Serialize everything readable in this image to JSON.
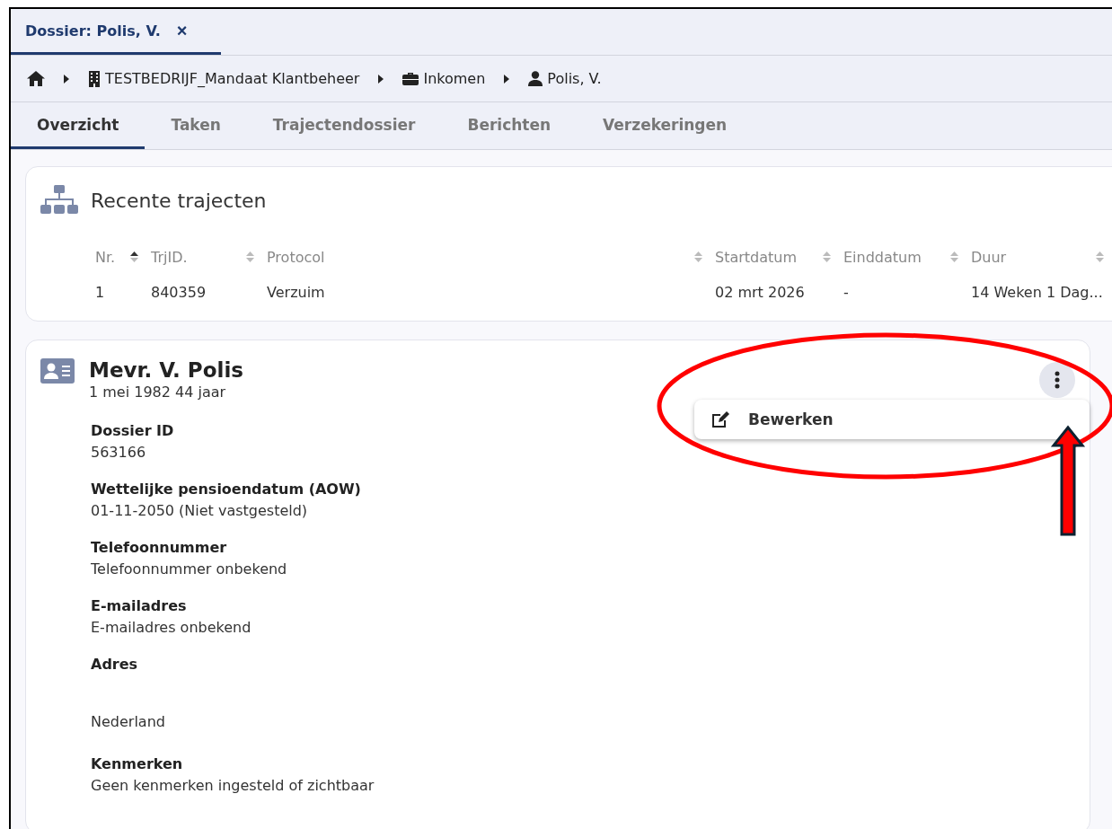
{
  "document_tab": {
    "title": "Dossier: Polis, V.",
    "close": "×"
  },
  "breadcrumb": [
    {
      "kind": "building",
      "label": "TESTBEDRIJF_Mandaat Klantbeheer"
    },
    {
      "kind": "briefcase",
      "label": "Inkomen"
    },
    {
      "kind": "user",
      "label": "Polis, V."
    }
  ],
  "tabs": [
    {
      "label": "Overzicht",
      "selected": true
    },
    {
      "label": "Taken",
      "selected": false
    },
    {
      "label": "Trajectendossier",
      "selected": false
    },
    {
      "label": "Berichten",
      "selected": false
    },
    {
      "label": "Verzekeringen",
      "selected": false
    }
  ],
  "recent": {
    "title": "Recente trajecten",
    "columns": [
      {
        "label": "Nr.",
        "sorted_ascending": true
      },
      {
        "label": "TrjID.",
        "sorted_ascending": false
      },
      {
        "label": "Protocol",
        "sorted_ascending": false
      },
      {
        "label": "Startdatum",
        "sorted_ascending": false
      },
      {
        "label": "Einddatum",
        "sorted_ascending": false
      },
      {
        "label": "Duur",
        "sorted_ascending": false
      }
    ],
    "rows": [
      [
        "1",
        "840359",
        "Verzuim",
        "02 mrt 2026",
        "-",
        "14 Weken 1 Dag..."
      ]
    ]
  },
  "person": {
    "name": "Mevr. V. Polis",
    "subtitle": "1 mei 1982 44 jaar",
    "menu": {
      "open": true,
      "items": [
        {
          "label": "Bewerken"
        }
      ]
    },
    "fields": [
      {
        "label": "Dossier ID",
        "value": "563166",
        "kind": "plain"
      },
      {
        "label": "Wettelijke pensioendatum (AOW)",
        "value": "01-11-2050 (Niet vastgesteld)",
        "kind": "plain"
      },
      {
        "label": "Telefoonnummer",
        "value": "Telefoonnummer onbekend",
        "kind": "plain"
      },
      {
        "label": "E-mailadres",
        "value": "E-mailadres onbekend",
        "kind": "plain"
      },
      {
        "label": "Adres",
        "value": "Nederland",
        "kind": "address"
      },
      {
        "label": "Kenmerken",
        "value": "Geen kenmerken ingesteld of zichtbaar",
        "kind": "plain"
      }
    ]
  },
  "annotations": [
    {
      "kind": "ellipse",
      "color": "#ff0000"
    },
    {
      "kind": "arrow",
      "color": "#ff0000"
    }
  ]
}
